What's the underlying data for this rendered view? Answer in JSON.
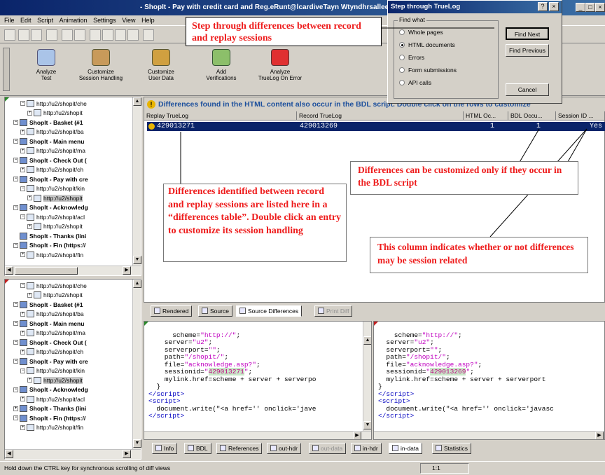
{
  "window": {
    "title_prefix": "- ShopIt - Pay with credit card and Reg.eRunt@lcardiveTayn  Wtyndhrsallee",
    "min_label": "_",
    "max_label": "□",
    "close_label": "×"
  },
  "menu": [
    "File",
    "Edit",
    "Script",
    "Animation",
    "Settings",
    "View",
    "Help"
  ],
  "bigbar": [
    {
      "label": "Analyze\nTest"
    },
    {
      "label": "Customize\nSession Handling"
    },
    {
      "label": "Customize\nUser Data"
    },
    {
      "label": "Add\nVerifications"
    },
    {
      "label": "Analyze\nTrueLog On Error"
    }
  ],
  "tree1": [
    {
      "indent": 2,
      "text": "http://u2/shopit/che",
      "pm": "−",
      "bold": false
    },
    {
      "indent": 3,
      "text": "http://u2/shopit",
      "pm": "+",
      "bold": false
    },
    {
      "indent": 1,
      "text": "ShopIt - Basket (#1",
      "pm": "−",
      "bold": true
    },
    {
      "indent": 2,
      "text": "http://u2/shopit/ba",
      "pm": "+",
      "bold": false
    },
    {
      "indent": 1,
      "text": "ShopIt - Main menu",
      "pm": "−",
      "bold": true
    },
    {
      "indent": 2,
      "text": "http://u2/shopit/ma",
      "pm": "+",
      "bold": false
    },
    {
      "indent": 1,
      "text": "ShopIt - Check Out (",
      "pm": "−",
      "bold": true
    },
    {
      "indent": 2,
      "text": "http://u2/shopit/ch",
      "pm": "+",
      "bold": false
    },
    {
      "indent": 1,
      "text": "ShopIt - Pay with cre",
      "pm": "−",
      "bold": true
    },
    {
      "indent": 2,
      "text": "http://u2/shopit/kin",
      "pm": "−",
      "bold": false
    },
    {
      "indent": 3,
      "text": "http://u2/shopit",
      "pm": "+",
      "bold": false,
      "sel": true
    },
    {
      "indent": 1,
      "text": "ShopIt - Acknowledg",
      "pm": "−",
      "bold": true
    },
    {
      "indent": 2,
      "text": "http://u2/shopit/acl",
      "pm": "−",
      "bold": false
    },
    {
      "indent": 3,
      "text": "http://u2/shopit",
      "pm": "+",
      "bold": false
    },
    {
      "indent": 1,
      "text": "ShopIt - Thanks (lini",
      "pm": "",
      "bold": true
    },
    {
      "indent": 1,
      "text": "ShopIt - Fin (https://",
      "pm": "−",
      "bold": true
    },
    {
      "indent": 2,
      "text": "http://u2/shopit/fin",
      "pm": "+",
      "bold": false
    }
  ],
  "tree2": [
    {
      "indent": 2,
      "text": "http://u2/shopit/che",
      "pm": "−",
      "bold": false
    },
    {
      "indent": 3,
      "text": "http://u2/shopit",
      "pm": "+",
      "bold": false
    },
    {
      "indent": 1,
      "text": "ShopIt - Basket (#1",
      "pm": "−",
      "bold": true
    },
    {
      "indent": 2,
      "text": "http://u2/shopit/ba",
      "pm": "+",
      "bold": false
    },
    {
      "indent": 1,
      "text": "ShopIt - Main menu",
      "pm": "−",
      "bold": true
    },
    {
      "indent": 2,
      "text": "http://u2/shopit/ma",
      "pm": "+",
      "bold": false
    },
    {
      "indent": 1,
      "text": "ShopIt - Check Out (",
      "pm": "−",
      "bold": true
    },
    {
      "indent": 2,
      "text": "http://u2/shopit/ch",
      "pm": "+",
      "bold": false
    },
    {
      "indent": 1,
      "text": "ShopIt - Pay with cre",
      "pm": "−",
      "bold": true
    },
    {
      "indent": 2,
      "text": "http://u2/shopit/kin",
      "pm": "−",
      "bold": false
    },
    {
      "indent": 3,
      "text": "http://u2/shopit",
      "pm": "+",
      "bold": false,
      "sel": true
    },
    {
      "indent": 1,
      "text": "ShopIt - Acknowledg",
      "pm": "−",
      "bold": true
    },
    {
      "indent": 2,
      "text": "http://u2/shopit/acl",
      "pm": "+",
      "bold": false
    },
    {
      "indent": 1,
      "text": "ShopIt - Thanks (lini",
      "pm": "+",
      "bold": true
    },
    {
      "indent": 1,
      "text": "ShopIt - Fin (https://",
      "pm": "−",
      "bold": true
    },
    {
      "indent": 2,
      "text": "http://u2/shopit/fin",
      "pm": "+",
      "bold": false
    }
  ],
  "message": "Differences found in the HTML content also occur in the BDL script. Double click on the rows to customize",
  "table": {
    "headers": [
      "Replay TrueLog",
      "Record TrueLog",
      "HTML Oc...",
      "BDL Occu...",
      "Session ID ..."
    ],
    "row": {
      "replay": "429013271",
      "record": "429013269",
      "html": "1",
      "bdl": "1",
      "session": "Yes"
    }
  },
  "viewtabs": [
    "Rendered",
    "Source",
    "Source Differences",
    "Print Diff"
  ],
  "code": {
    "scheme": "\"http://\"",
    "server": "\"u2\"",
    "serverport": "\"\"",
    "path": "\"/shopit/\"",
    "file": "\"acknowledge.asp?\"",
    "sid_left": "429013271",
    "sid_right": "429013269",
    "href_left": "mylink.href=scheme + server + serverpo",
    "href_right": "mylink.href=scheme + server + serverport",
    "write_left": "document.write(\"<a href='' onclick='jave",
    "write_right": "document.write(\"<a href='' onclick='javasc"
  },
  "bottomtabs": [
    "Info",
    "BDL",
    "References",
    "out-hdr",
    "out-data",
    "in-hdr",
    "in-data",
    "Statistics"
  ],
  "status": {
    "hint": "Hold down the CTRL key for synchronous scrolling of diff views",
    "pos": "1:1"
  },
  "dialog": {
    "title": "Step through TrueLog",
    "help": "?",
    "close": "×",
    "group": "Find what",
    "options": [
      "Whole pages",
      "HTML documents",
      "Errors",
      "Form submissions",
      "API calls"
    ],
    "selected": 1,
    "find_next": "Find Next",
    "find_prev": "Find Previous",
    "cancel": "Cancel"
  },
  "callouts": {
    "top": "Step through differences between record and replay sessions",
    "left": "Differences identified between record and replay sessions are listed here in a “differences table”. Double click an entry to customize its session handling",
    "right": "Differences can be customized only if they occur in the BDL script",
    "bottom": "This column indicates whether or not differences may be session related"
  },
  "colors": {
    "accent": "#0a246a",
    "callout": "#ee1c1c",
    "info": "#1c4f9c"
  }
}
